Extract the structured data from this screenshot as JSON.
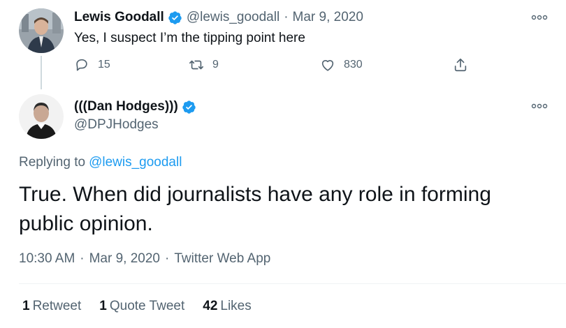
{
  "reply_tweet": {
    "display_name": "Lewis Goodall",
    "handle": "@lewis_goodall",
    "date": "Mar 9, 2020",
    "text": "Yes, I suspect I’m the tipping point here",
    "replies": "15",
    "retweets": "9",
    "likes": "830",
    "icons": [
      "verified-badge-icon",
      "reply-icon",
      "retweet-icon",
      "like-icon",
      "share-icon",
      "more-icon"
    ]
  },
  "main_tweet": {
    "display_name": "(((Dan Hodges)))",
    "handle": "@DPJHodges",
    "replying_label": "Replying to",
    "replying_to": "@lewis_goodall",
    "text": "True. When did journalists have any role in forming public opinion.",
    "time": "10:30 AM",
    "date": "Mar 9, 2020",
    "source": "Twitter Web App",
    "separator": "·",
    "stats": {
      "retweets_count": "1",
      "retweets_label": "Retweet",
      "quotes_count": "1",
      "quotes_label": "Quote Tweet",
      "likes_count": "42",
      "likes_label": "Likes"
    }
  },
  "colors": {
    "text": "#0f1419",
    "secondary": "#536471",
    "accent": "#1d9bf0",
    "divider": "#eff3f4"
  }
}
